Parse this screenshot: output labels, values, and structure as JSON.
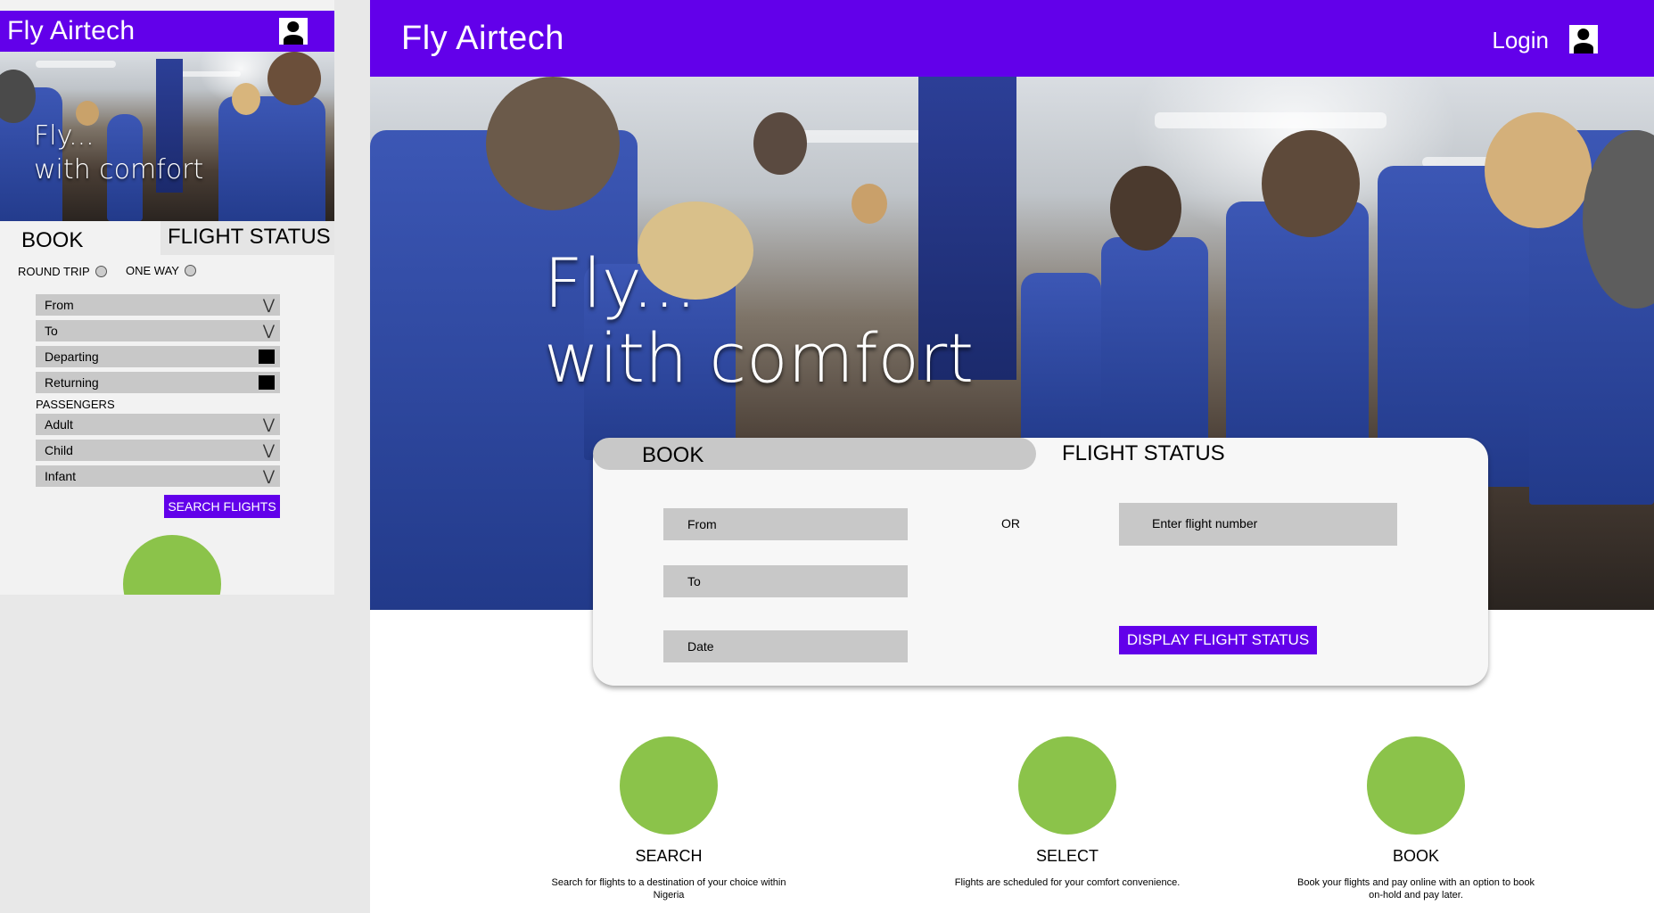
{
  "mobile": {
    "brand": "Fly Airtech",
    "hero_line1": "Fly...",
    "hero_line2": "with comfort",
    "tab_book": "BOOK",
    "tab_status": "FLIGHT STATUS",
    "round_trip": "ROUND TRIP",
    "one_way": "ONE WAY",
    "fields": {
      "from": "From",
      "to": "To",
      "departing": "Departing",
      "returning": "Returning",
      "adult": "Adult",
      "child": "Child",
      "infant": "Infant"
    },
    "passengers_label": "PASSENGERS",
    "search_button": "SEARCH FLIGHTS"
  },
  "desktop": {
    "brand": "Fly Airtech",
    "login": "Login",
    "hero_line1": "Fly...",
    "hero_line2": "with comfort",
    "tab_book": "BOOK",
    "tab_status": "FLIGHT STATUS",
    "from_placeholder": "From",
    "to_placeholder": "To",
    "date_placeholder": "Date",
    "or_label": "OR",
    "flight_number_placeholder": "Enter flight number",
    "display_button": "DISPLAY FLIGHT STATUS",
    "steps": [
      {
        "title": "SEARCH",
        "desc": "Search for flights to a destination of your choice within Nigeria"
      },
      {
        "title": "SELECT",
        "desc": "Flights are scheduled for your comfort   convenience."
      },
      {
        "title": "BOOK",
        "desc": "Book your flights and pay online with an option to book on-hold and pay later."
      }
    ]
  },
  "colors": {
    "brand_purple": "#6200ea",
    "accent_green": "#8bc34a",
    "field_gray": "#c8c8c8"
  },
  "icons": [
    "user-icon",
    "chevron-down-icon",
    "calendar-icon",
    "radio-icon"
  ]
}
